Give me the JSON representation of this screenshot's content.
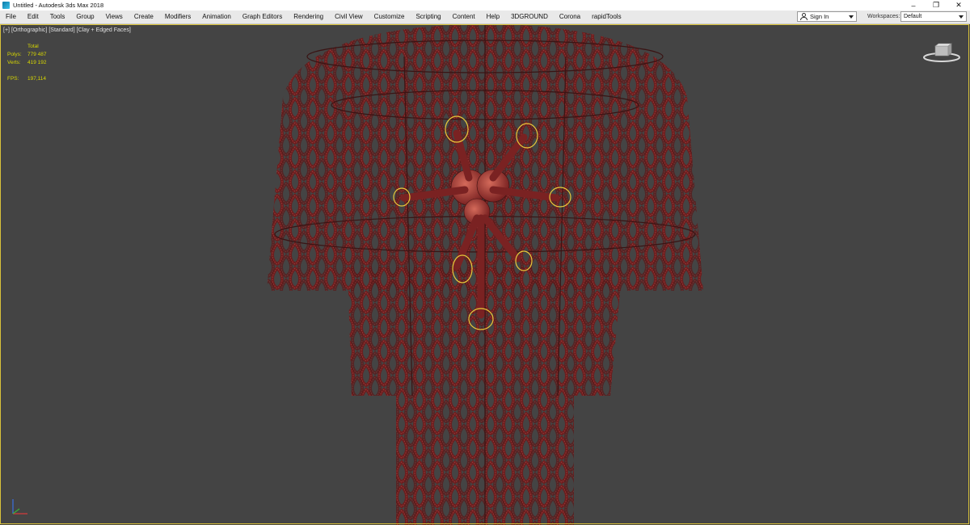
{
  "window": {
    "title": "Untitled - Autodesk 3ds Max 2018"
  },
  "menu": [
    "File",
    "Edit",
    "Tools",
    "Group",
    "Views",
    "Create",
    "Modifiers",
    "Animation",
    "Graph Editors",
    "Rendering",
    "Civil View",
    "Customize",
    "Scripting",
    "Content",
    "Help",
    "3DGROUND",
    "Corona",
    "rapidTools"
  ],
  "signin": {
    "label": "Sign In"
  },
  "workspaces": {
    "label": "Workspaces:",
    "value": "Default"
  },
  "viewport": {
    "label": [
      "[+]",
      "[Orthographic]",
      "[Standard]",
      "[Clay + Edged Faces]"
    ],
    "stats": {
      "header": "Total",
      "polys_label": "Polys:",
      "polys": "779 487",
      "verts_label": "Verts:",
      "verts": "419 192",
      "fps_label": "FPS:",
      "fps": "197,114"
    }
  },
  "colors": {
    "model": "#6b1e1e",
    "model_light": "#9a3a3a",
    "selection": "#e8c93a",
    "viewport_bg": "#444444",
    "stats_text": "#d7d700"
  },
  "icons": [
    "app-icon",
    "minimize-icon",
    "restore-icon",
    "close-icon",
    "user-icon",
    "viewcube-icon",
    "axis-tripod-icon"
  ]
}
